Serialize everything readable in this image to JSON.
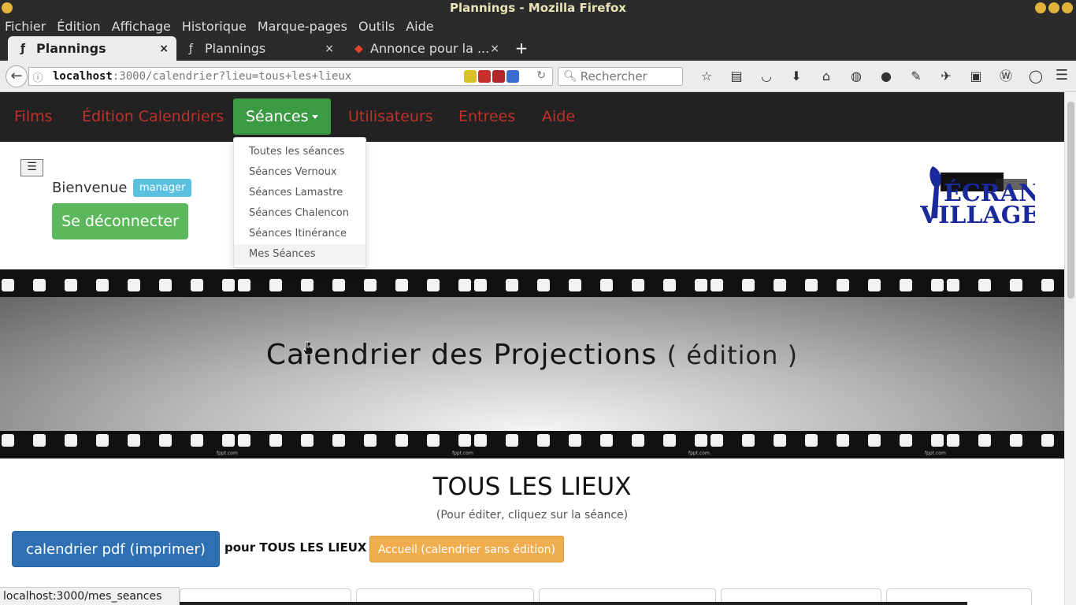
{
  "window": {
    "title": "Plannings - Mozilla Firefox"
  },
  "menubar": {
    "items": [
      "Fichier",
      "Édition",
      "Affichage",
      "Historique",
      "Marque-pages",
      "Outils",
      "Aide"
    ]
  },
  "tabs": [
    {
      "label": "Plannings",
      "icon": "f-icon"
    },
    {
      "label": "Plannings",
      "icon": "f-icon"
    },
    {
      "label": "Annonce pour la ...",
      "icon": "gitlab-icon"
    }
  ],
  "tab_close": "×",
  "new_tab": "+",
  "urlbar": {
    "host": "localhost",
    "rest": ":3000/calendrier?lieu=tous+les+lieux"
  },
  "search": {
    "placeholder": "Rechercher"
  },
  "appnav": {
    "items": [
      "Films",
      "Édition Calendriers",
      "Séances",
      "Utilisateurs",
      "Entrees",
      "Aide"
    ],
    "active": "Séances",
    "color_link": "#c0312b",
    "color_active": "#3a9b42"
  },
  "dropdown": {
    "items": [
      "Toutes les séances",
      "Séances Vernoux",
      "Séances Lamastre",
      "Séances Chalencon",
      "Séances Itinérance",
      "Mes Séances"
    ],
    "hovered": "Mes Séances"
  },
  "menu_toggle": "☰",
  "user": {
    "welcome": "Bienvenue !",
    "role_badge": "manager",
    "logout": "Se déconnecter"
  },
  "logo": {
    "text": "ÉCRAN VILLAGE"
  },
  "banner": {
    "title": "Calendrier des Projections",
    "subtitle": "( édition )",
    "credit": "fppt.com"
  },
  "main": {
    "place": "TOUS LES LIEUX",
    "hint": "(Pour éditer, cliquez sur la séance)",
    "pdf_button": "calendrier pdf (imprimer)",
    "pour_label": "pour TOUS LES LIEUX",
    "accueil_button": "Accueil (calendrier sans édition)"
  },
  "status": {
    "url": "localhost:3000/mes_seances"
  }
}
